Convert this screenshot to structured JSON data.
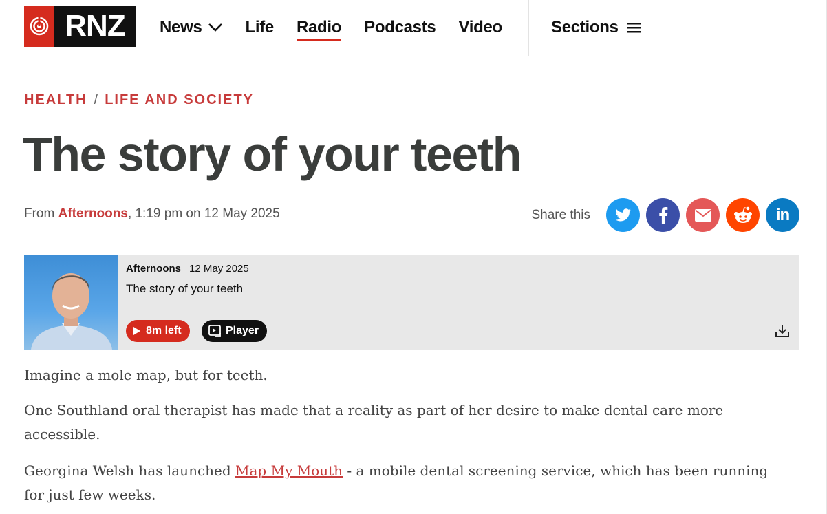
{
  "header": {
    "logo_text": "RNZ",
    "nav": [
      {
        "label": "News"
      },
      {
        "label": "Life"
      },
      {
        "label": "Radio"
      },
      {
        "label": "Podcasts"
      },
      {
        "label": "Video"
      }
    ],
    "sections_label": "Sections"
  },
  "article": {
    "breadcrumb": [
      "HEALTH",
      "LIFE AND SOCIETY"
    ],
    "title": "The story of your teeth",
    "byline": {
      "prefix": "From",
      "program": "Afternoons",
      "time": ", 1:19 pm on 12 May 2025"
    },
    "share_label": "Share this",
    "share_icons": [
      "twitter-icon",
      "facebook-icon",
      "email-icon",
      "reddit-icon",
      "linkedin-icon"
    ],
    "share_colors": [
      "#1d9bf0",
      "#3b4fa8",
      "#e45858",
      "#ff4500",
      "#0a7ac2"
    ]
  },
  "player": {
    "program": "Afternoons",
    "date": "12 May 2025",
    "title": "The story of your teeth",
    "play_label": "8m left",
    "player_label": "Player"
  },
  "body": {
    "p1": "Imagine a mole map, but for teeth.",
    "p2": "One Southland oral therapist has made that a reality as part of her desire to make dental care more accessible.",
    "p3_before": "Georgina Welsh has launched ",
    "p3_link": "Map My Mouth",
    "p3_after": " - a mobile dental screening service, which has been running for just few weeks."
  }
}
